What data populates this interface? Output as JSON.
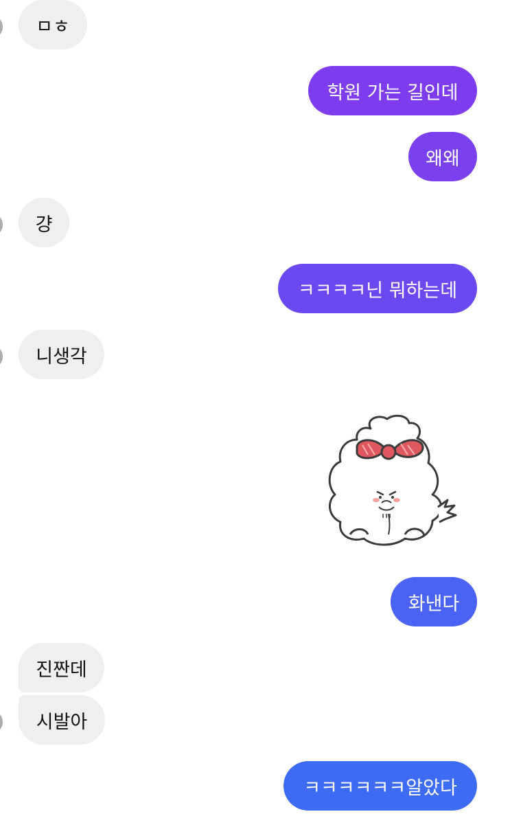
{
  "messages": [
    {
      "id": "m1",
      "side": "in",
      "text": "ㅁㅎ"
    },
    {
      "id": "m2",
      "side": "out",
      "text": "학원 가는 길인데"
    },
    {
      "id": "m3",
      "side": "out",
      "text": "왜왜"
    },
    {
      "id": "m4",
      "side": "in",
      "text": "걍"
    },
    {
      "id": "m5",
      "side": "out",
      "text": "ㅋㅋㅋㅋ닌 뭐하는데"
    },
    {
      "id": "m6",
      "side": "in",
      "text": "니생각"
    },
    {
      "id": "m7",
      "side": "out",
      "type": "sticker",
      "sticker": "angry-white-puppy-with-red-bow"
    },
    {
      "id": "m8",
      "side": "out",
      "text": "화낸다"
    },
    {
      "id": "m9",
      "side": "in",
      "text": "진짠데"
    },
    {
      "id": "m10",
      "side": "in",
      "text": "시발아"
    },
    {
      "id": "m11",
      "side": "out",
      "text": "ㅋㅋㅋㅋㅋㅋ알았다"
    }
  ],
  "colors": {
    "incoming_bubble": "#efefef",
    "outgoing_gradient_top": "#7e3cef",
    "outgoing_gradient_bottom": "#3e6bf4"
  }
}
